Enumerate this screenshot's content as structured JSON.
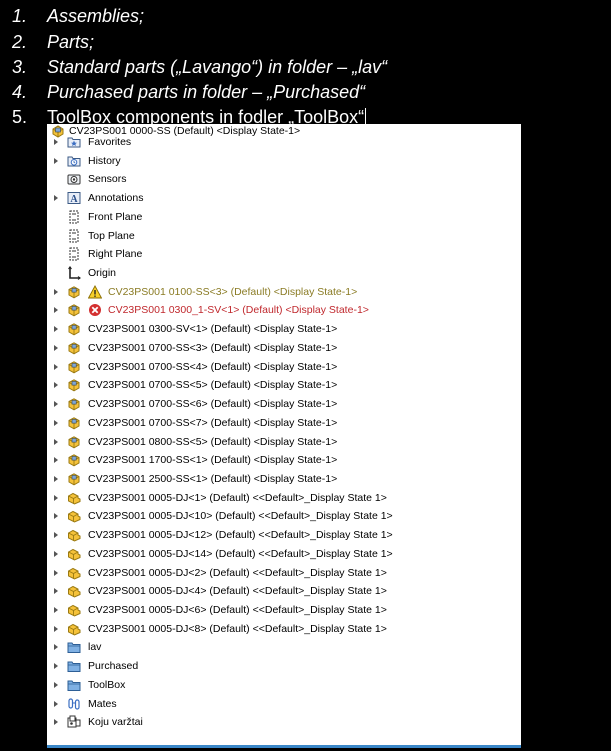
{
  "doc_list": [
    {
      "num": "1.",
      "text": "Assemblies;",
      "italic": true
    },
    {
      "num": "2.",
      "text": "Parts;",
      "italic": true
    },
    {
      "num": "3.",
      "text": "Standard parts („Lavango“) in folder – „lav“",
      "italic": true
    },
    {
      "num": "4.",
      "text": "Purchased parts in folder – „Purchased“",
      "italic": true
    },
    {
      "num": "5.",
      "text": "ToolBox components in fodler „ToolBox“",
      "italic": false
    }
  ],
  "tree": {
    "root_label": "CV23PS001 0000-SS (Default) <Display State-1>",
    "items": [
      {
        "label": "Favorites",
        "icon": "favorites-icon",
        "expander": true
      },
      {
        "label": "History",
        "icon": "history-icon",
        "expander": true
      },
      {
        "label": "Sensors",
        "icon": "sensors-icon",
        "expander": false
      },
      {
        "label": "Annotations",
        "icon": "annotations-icon",
        "expander": true
      },
      {
        "label": "Front Plane",
        "icon": "plane-icon",
        "expander": false
      },
      {
        "label": "Top Plane",
        "icon": "plane-icon",
        "expander": false
      },
      {
        "label": "Right Plane",
        "icon": "plane-icon",
        "expander": false
      },
      {
        "label": "Origin",
        "icon": "origin-icon",
        "expander": false
      },
      {
        "label": "CV23PS001 0100-SS<3> (Default) <Display State-1>",
        "icon": "assembly-icon",
        "expander": true,
        "status": "warning"
      },
      {
        "label": "CV23PS001 0300_1-SV<1> (Default) <Display State-1>",
        "icon": "assembly-icon",
        "expander": true,
        "status": "error"
      },
      {
        "label": "CV23PS001 0300-SV<1> (Default) <Display State-1>",
        "icon": "assembly-icon",
        "expander": true
      },
      {
        "label": "CV23PS001 0700-SS<3> (Default) <Display State-1>",
        "icon": "assembly-icon",
        "expander": true
      },
      {
        "label": "CV23PS001 0700-SS<4> (Default) <Display State-1>",
        "icon": "assembly-icon",
        "expander": true
      },
      {
        "label": "CV23PS001 0700-SS<5> (Default) <Display State-1>",
        "icon": "assembly-icon",
        "expander": true
      },
      {
        "label": "CV23PS001 0700-SS<6> (Default) <Display State-1>",
        "icon": "assembly-icon",
        "expander": true
      },
      {
        "label": "CV23PS001 0700-SS<7> (Default) <Display State-1>",
        "icon": "assembly-icon",
        "expander": true
      },
      {
        "label": "CV23PS001 0800-SS<5> (Default) <Display State-1>",
        "icon": "assembly-icon",
        "expander": true
      },
      {
        "label": "CV23PS001 1700-SS<1> (Default) <Display State-1>",
        "icon": "assembly-icon",
        "expander": true
      },
      {
        "label": "CV23PS001 2500-SS<1> (Default) <Display State-1>",
        "icon": "assembly-icon",
        "expander": true
      },
      {
        "label": "CV23PS001 0005-DJ<1> (Default) <<Default>_Display State 1>",
        "icon": "part-icon",
        "expander": true
      },
      {
        "label": "CV23PS001 0005-DJ<10> (Default) <<Default>_Display State 1>",
        "icon": "part-icon",
        "expander": true
      },
      {
        "label": "CV23PS001 0005-DJ<12> (Default) <<Default>_Display State 1>",
        "icon": "part-icon",
        "expander": true
      },
      {
        "label": "CV23PS001 0005-DJ<14> (Default) <<Default>_Display State 1>",
        "icon": "part-icon",
        "expander": true
      },
      {
        "label": "CV23PS001 0005-DJ<2> (Default) <<Default>_Display State 1>",
        "icon": "part-icon",
        "expander": true
      },
      {
        "label": "CV23PS001 0005-DJ<4> (Default) <<Default>_Display State 1>",
        "icon": "part-icon",
        "expander": true
      },
      {
        "label": "CV23PS001 0005-DJ<6> (Default) <<Default>_Display State 1>",
        "icon": "part-icon",
        "expander": true
      },
      {
        "label": "CV23PS001 0005-DJ<8> (Default) <<Default>_Display State 1>",
        "icon": "part-icon",
        "expander": true
      },
      {
        "label": "lav",
        "icon": "folder-icon",
        "expander": true
      },
      {
        "label": "Purchased",
        "icon": "folder-icon",
        "expander": true
      },
      {
        "label": "ToolBox",
        "icon": "folder-icon",
        "expander": true
      },
      {
        "label": "Mates",
        "icon": "mates-icon",
        "expander": true
      },
      {
        "label": "Koju varžtai",
        "icon": "pattern-icon",
        "expander": true
      }
    ]
  }
}
